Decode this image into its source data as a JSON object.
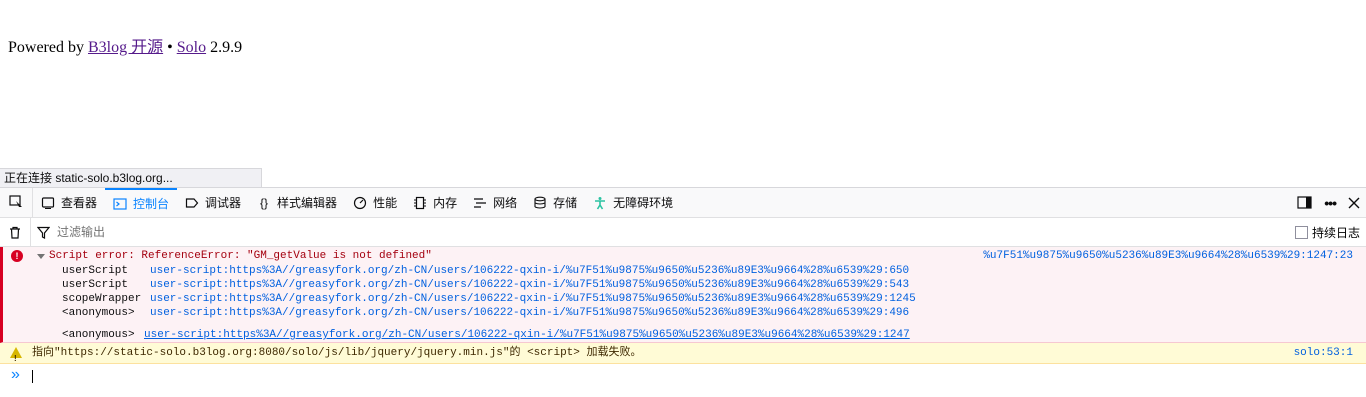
{
  "page": {
    "footer_prefix": "Powered by",
    "link_b3log": "B3log 开源",
    "separator": "•",
    "link_solo": "Solo",
    "version": "2.9.9"
  },
  "status_bar": {
    "text": "正在连接 static-solo.b3log.org..."
  },
  "devtools": {
    "tabs": [
      {
        "label": "查看器",
        "icon": "inspector-icon"
      },
      {
        "label": "控制台",
        "icon": "console-icon"
      },
      {
        "label": "调试器",
        "icon": "debugger-icon"
      },
      {
        "label": "样式编辑器",
        "icon": "style-editor-icon"
      },
      {
        "label": "性能",
        "icon": "performance-icon"
      },
      {
        "label": "内存",
        "icon": "memory-icon"
      },
      {
        "label": "网络",
        "icon": "network-icon"
      },
      {
        "label": "存储",
        "icon": "storage-icon"
      },
      {
        "label": "无障碍环境",
        "icon": "accessibility-icon"
      }
    ],
    "active_tab": "控制台",
    "accent": "#0a84ff",
    "filter": {
      "placeholder": "过滤输出",
      "value": ""
    },
    "persist_logs_label": "持续日志",
    "persist_logs_checked": false
  },
  "console": {
    "error": {
      "text": "Script error:  ReferenceError: \"GM_getValue is not defined\"",
      "location": "%u7F51%u9875%u9650%u5236%u89E3%u9664%28%u6539%29:1247:23",
      "frames": [
        {
          "fn": "userScript",
          "src": "user-script:https%3A//greasyfork.org/zh-CN/users/106222-qxin-i/%u7F51%u9875%u9650%u5236%u89E3%u9664%28%u6539%29:650"
        },
        {
          "fn": "userScript",
          "src": "user-script:https%3A//greasyfork.org/zh-CN/users/106222-qxin-i/%u7F51%u9875%u9650%u5236%u89E3%u9664%28%u6539%29:543"
        },
        {
          "fn": "scopeWrapper",
          "src": "user-script:https%3A//greasyfork.org/zh-CN/users/106222-qxin-i/%u7F51%u9875%u9650%u5236%u89E3%u9664%28%u6539%29:1245"
        },
        {
          "fn": "<anonymous>",
          "src": "user-script:https%3A//greasyfork.org/zh-CN/users/106222-qxin-i/%u7F51%u9875%u9650%u5236%u89E3%u9664%28%u6539%29:496"
        }
      ],
      "last_frame": {
        "fn": "<anonymous>",
        "src": "user-script:https%3A//greasyfork.org/zh-CN/users/106222-qxin-i/%u7F51%u9875%u9650%u5236%u89E3%u9664%28%u6539%29:1247"
      }
    },
    "warning": {
      "text": "指向\"https://static-solo.b3log.org:8080/solo/js/lib/jquery/jquery.min.js\"的 <script> 加载失败。",
      "location": "solo:53:1"
    },
    "prompt": "»"
  }
}
